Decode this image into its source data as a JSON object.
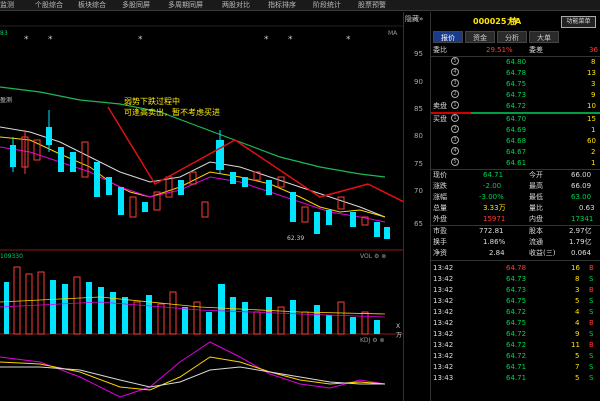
{
  "menu": {
    "items": [
      "监测",
      "个股综合",
      "板块综合",
      "多股同屏",
      "多周期同屏",
      "两股对比",
      "指标排序",
      "阶段统计",
      "股票预警"
    ]
  },
  "chart": {
    "annotation_line1": "弱势下跌过程中",
    "annotation_line2": "可逢高卖出，暂不考虑买进",
    "low_price_label": "62.39",
    "left_label_top": "83",
    "left_label_ma": "MA",
    "left_label_mid": "盈测",
    "left_label_vol": "109330",
    "vol_label": "VOL",
    "xwan_label": "X万",
    "kdj_label": "KDJ"
  },
  "yaxis": {
    "ticks": [
      "95",
      "90",
      "85",
      "80",
      "75",
      "70",
      "65"
    ]
  },
  "panel": {
    "hide_label": "隐藏»",
    "code": "000025 特",
    "name": "力A",
    "func_btn": "功能菜单",
    "tabs": [
      "报价",
      "资金",
      "分析",
      "大单"
    ],
    "weibi_label": "委比",
    "weibi_value": "29.51%",
    "weicha_label": "委差",
    "weicha_value": "36",
    "sell": [
      {
        "no": "5",
        "price": "64.80",
        "vol": "8"
      },
      {
        "no": "4",
        "price": "64.78",
        "vol": "13"
      },
      {
        "no": "3",
        "price": "64.75",
        "vol": "3"
      },
      {
        "no": "2",
        "price": "64.73",
        "vol": "9"
      },
      {
        "no": "1",
        "price": "64.72",
        "vol": "10"
      }
    ],
    "sell_label": "卖盘",
    "buy_label": "买盘",
    "buy": [
      {
        "no": "1",
        "price": "64.70",
        "vol": "15"
      },
      {
        "no": "2",
        "price": "64.69",
        "vol": "1"
      },
      {
        "no": "3",
        "price": "64.68",
        "vol": "60"
      },
      {
        "no": "4",
        "price": "64.67",
        "vol": "2"
      },
      {
        "no": "5",
        "price": "64.61",
        "vol": "1"
      }
    ],
    "stats": [
      {
        "l1": "现价",
        "v1": "64.71",
        "c1": "green",
        "l2": "今开",
        "v2": "66.00",
        "c2": "white"
      },
      {
        "l1": "涨跌",
        "v1": "-2.00",
        "c1": "green",
        "l2": "最高",
        "v2": "66.09",
        "c2": "white"
      },
      {
        "l1": "涨幅",
        "v1": "-3.00%",
        "c1": "green",
        "l2": "最低",
        "v2": "63.00",
        "c2": "green"
      },
      {
        "l1": "总量",
        "v1": "3.33万",
        "c1": "yellow",
        "l2": "量比",
        "v2": "0.63",
        "c2": "white"
      },
      {
        "l1": "外盘",
        "v1": "15971",
        "c1": "red",
        "l2": "内盘",
        "v2": "17341",
        "c2": "green"
      },
      {
        "l1": "市盈",
        "v1": "772.81",
        "c1": "white",
        "l2": "股本",
        "v2": "2.97亿",
        "c2": "white"
      },
      {
        "l1": "换手",
        "v1": "1.86%",
        "c1": "white",
        "l2": "流通",
        "v2": "1.79亿",
        "c2": "white"
      },
      {
        "l1": "净资",
        "v1": "2.84",
        "c1": "white",
        "l2": "收益(三)",
        "v2": "0.064",
        "c2": "white"
      }
    ],
    "ticks": [
      {
        "time": "13:42",
        "price": "64.78",
        "vol": "16",
        "side": "B",
        "c": "red"
      },
      {
        "time": "13:42",
        "price": "64.73",
        "vol": "8",
        "side": "S",
        "c": "green"
      },
      {
        "time": "13:42",
        "price": "64.73",
        "vol": "3",
        "side": "B",
        "c": "red"
      },
      {
        "time": "13:42",
        "price": "64.75",
        "vol": "5",
        "side": "S",
        "c": "green"
      },
      {
        "time": "13:42",
        "price": "64.72",
        "vol": "4",
        "side": "S",
        "c": "green"
      },
      {
        "time": "13:42",
        "price": "64.75",
        "vol": "4",
        "side": "B",
        "c": "red"
      },
      {
        "time": "13:42",
        "price": "64.72",
        "vol": "9",
        "side": "S",
        "c": "green"
      },
      {
        "time": "13:42",
        "price": "64.72",
        "vol": "11",
        "side": "B",
        "c": "red"
      },
      {
        "time": "13:42",
        "price": "64.72",
        "vol": "5",
        "side": "S",
        "c": "green"
      },
      {
        "time": "13:42",
        "price": "64.71",
        "vol": "7",
        "side": "S",
        "c": "green"
      },
      {
        "time": "13:43",
        "price": "64.71",
        "vol": "5",
        "side": "S",
        "c": "green"
      }
    ]
  }
}
